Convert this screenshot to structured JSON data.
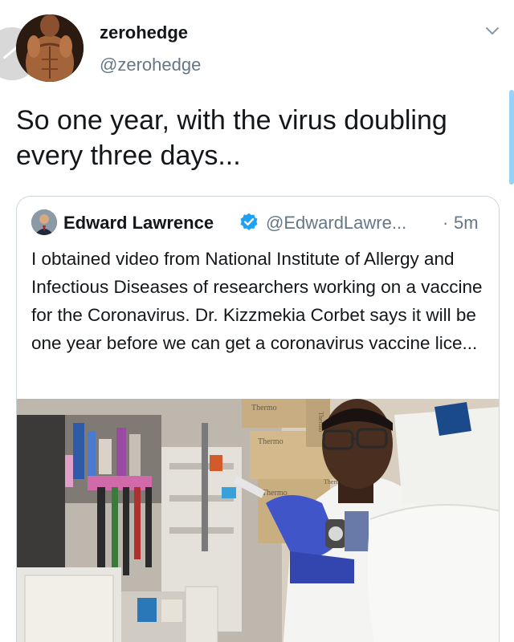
{
  "tweet": {
    "display_name": "zerohedge",
    "handle": "@zerohedge",
    "text": "So one year, with the virus doubling every three days..."
  },
  "quoted_tweet": {
    "display_name": "Edward Lawrence",
    "handle": "@EdwardLawre...",
    "separator": "·",
    "time": "5m",
    "text": "I obtained video from National Institute of Allergy and Infectious Diseases of researchers working on a vaccine for the Coronavirus. Dr. Kizzmekia Corbet says it will be one year before we can get a coronavirus vaccine lice...",
    "media": {
      "box_labels": [
        "Thermo",
        "Thermo",
        "Thermo",
        "Thermo",
        "Thermo"
      ]
    }
  },
  "icons": {
    "caret": "chevron-down-icon",
    "verified": "verified-badge-icon"
  },
  "colors": {
    "text": "#14171a",
    "secondary": "#657786",
    "accent": "#1da1f2",
    "border": "#ccd6dd"
  }
}
